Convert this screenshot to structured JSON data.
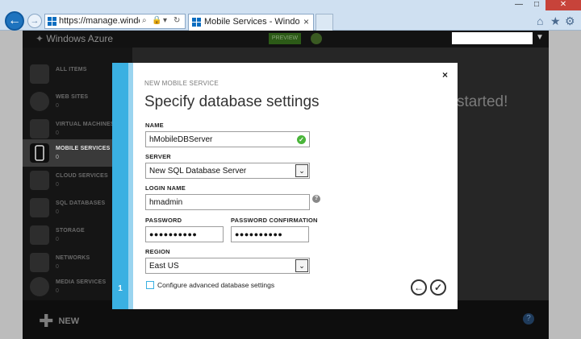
{
  "browser": {
    "url": "https://manage.windowsazur...",
    "tab_title": "Mobile Services - Windows...",
    "tab_close": "×",
    "refresh": "↻",
    "search": "⌕",
    "dropdown": "▾",
    "stop": "✕",
    "window_min": "—",
    "window_max": "□",
    "window_close": "✕",
    "tools": {
      "home": "⌂",
      "favorites": "★",
      "settings": "⚙"
    }
  },
  "portal": {
    "logo": "Windows Azure",
    "preview_label": "PREVIEW",
    "main_text": "started!",
    "new_button": "NEW",
    "help": "?",
    "sidebar": [
      {
        "label": "ALL ITEMS",
        "count": "",
        "icon": "grid-icon"
      },
      {
        "label": "WEB SITES",
        "count": "0",
        "icon": "globe-icon"
      },
      {
        "label": "VIRTUAL MACHINES",
        "count": "0",
        "icon": "monitor-icon"
      },
      {
        "label": "MOBILE SERVICES",
        "count": "0",
        "icon": "mobile-icon",
        "active": true
      },
      {
        "label": "CLOUD SERVICES",
        "count": "0",
        "icon": "cloud-icon"
      },
      {
        "label": "SQL DATABASES",
        "count": "0",
        "icon": "database-icon"
      },
      {
        "label": "STORAGE",
        "count": "0",
        "icon": "storage-icon"
      },
      {
        "label": "NETWORKS",
        "count": "0",
        "icon": "network-icon"
      },
      {
        "label": "MEDIA SERVICES",
        "count": "0",
        "icon": "media-icon"
      }
    ]
  },
  "dialog": {
    "subtitle": "NEW MOBILE SERVICE",
    "title": "Specify database settings",
    "close": "×",
    "step": "1",
    "name_label": "NAME",
    "name_value": "hMobileDBServer",
    "server_label": "SERVER",
    "server_value": "New SQL Database Server",
    "login_label": "LOGIN NAME",
    "login_value": "hmadmin",
    "password_label": "PASSWORD",
    "password_value": "●●●●●●●●●●",
    "confirm_label": "PASSWORD CONFIRMATION",
    "confirm_value": "●●●●●●●●●●",
    "region_label": "REGION",
    "region_value": "East US",
    "advanced_label": "Configure advanced database settings",
    "back": "←",
    "finish": "✓",
    "valid": "✓",
    "info": "?",
    "select_arrow": "⌄"
  },
  "colors": {
    "accent": "#3ab0e2",
    "valid_green": "#4ab53a"
  }
}
